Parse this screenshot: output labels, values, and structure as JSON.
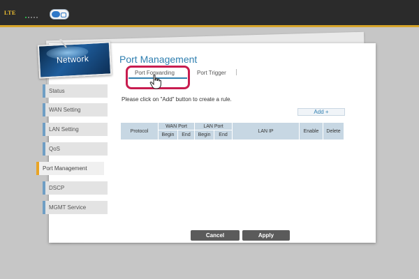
{
  "status_bar": {
    "network_type": "LTE",
    "signal_icon": "signal-bars-icon",
    "wifi_icon": "wifi-toggle-icon",
    "accent_color": "#d6a42a"
  },
  "logo": {
    "label": "Network"
  },
  "sidebar": {
    "items": [
      {
        "label": "Status"
      },
      {
        "label": "WAN Setting"
      },
      {
        "label": "LAN Setting"
      },
      {
        "label": "QoS"
      },
      {
        "label": "Port Management",
        "active": true
      },
      {
        "label": "DSCP"
      },
      {
        "label": "MGMT Service"
      }
    ]
  },
  "main": {
    "title": "Port Management",
    "tabs": [
      {
        "label": "Port Forwarding",
        "active": true
      },
      {
        "label": "Port Trigger"
      }
    ],
    "instruction": "Please click on \"Add\" button to create a rule.",
    "add_label": "Add  +",
    "table": {
      "headers": {
        "protocol": "Protocol",
        "wan_port": "WAN Port",
        "lan_port": "LAN Port",
        "lan_ip": "LAN IP",
        "enable": "Enable",
        "delete": "Delete",
        "begin": "Begin",
        "end": "End"
      }
    }
  },
  "footer": {
    "cancel_label": "Cancel",
    "apply_label": "Apply"
  },
  "colors": {
    "highlight": "#c81c4f",
    "title": "#2f7fb0",
    "nav_active": "#e9a425"
  }
}
